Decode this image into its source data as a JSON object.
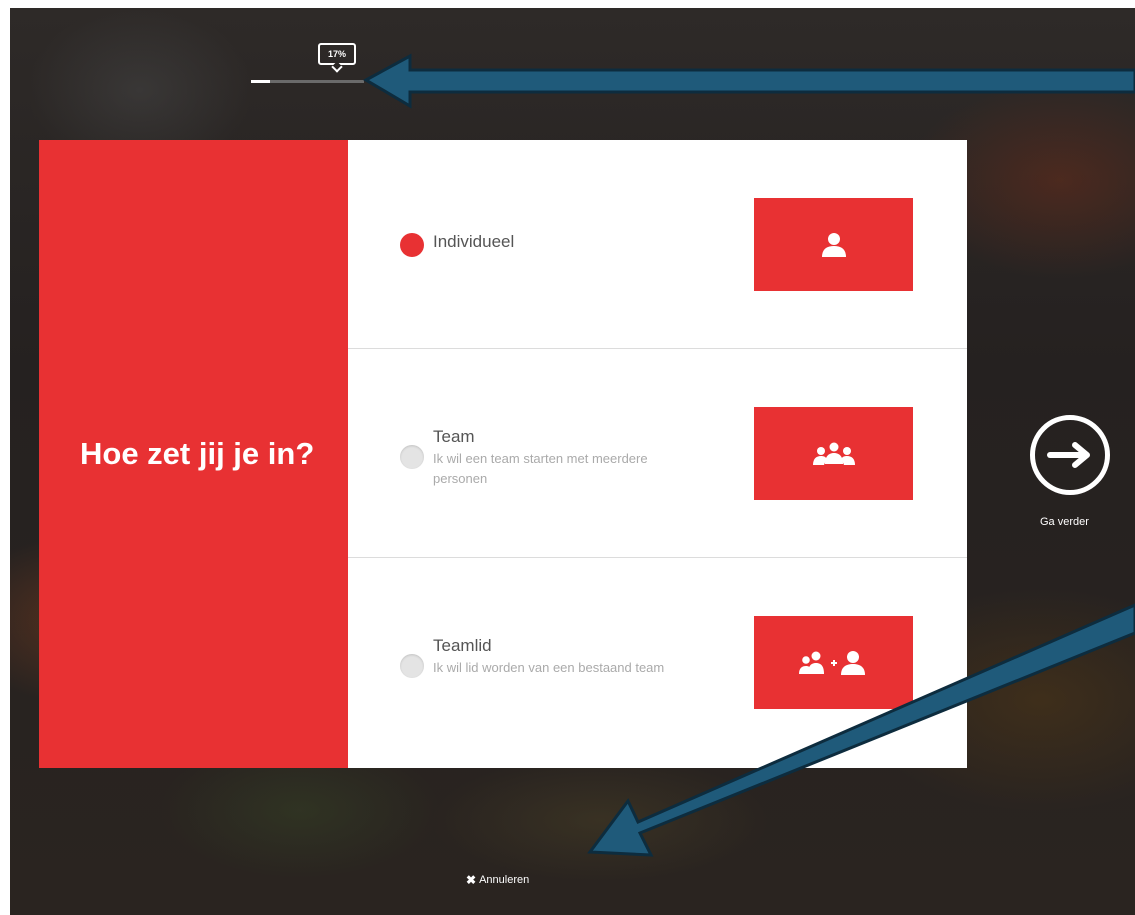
{
  "progress": {
    "label": "17%",
    "fraction": 0.17
  },
  "question": "Hoe zet jij je in?",
  "options": [
    {
      "title": "Individueel",
      "description": "",
      "selected": true,
      "icon": "person-icon"
    },
    {
      "title": "Team",
      "description": "Ik wil een team starten met meerdere personen",
      "selected": false,
      "icon": "group-icon"
    },
    {
      "title": "Teamlid",
      "description": "Ik wil lid worden van een bestaand team",
      "selected": false,
      "icon": "group-plus-person-icon"
    }
  ],
  "next": {
    "label": "Ga verder",
    "icon": "arrow-right-icon"
  },
  "cancel": {
    "label": "Annuleren",
    "icon": "close-icon"
  },
  "colors": {
    "accent": "#e83133",
    "annotation_arrow": "#1f5a7a"
  }
}
